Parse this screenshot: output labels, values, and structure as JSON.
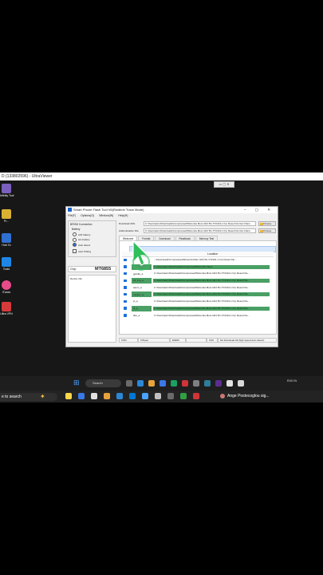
{
  "remote_viewer": {
    "title": "D (133802596) - UltraViewer",
    "controls": "▭ ▢ ✕"
  },
  "desktop_icons": [
    {
      "label": "Infinity Tool",
      "color": "#7a5fbf"
    },
    {
      "label": "Pr...",
      "color": "#d9b033"
    },
    {
      "label": "Hub Yo",
      "color": "#2f6fd0"
    },
    {
      "label": "Tools",
      "color": "#1e87e5"
    },
    {
      "label": "iTunes",
      "color": "#e84b8a"
    },
    {
      "label": "Ultra VPN",
      "color": "#d63a3a"
    }
  ],
  "app_window": {
    "title": "Smart Phone Flash Tool V6(Runtime Trace Mode)",
    "window_controls": "–  ▢  ✕",
    "menu": [
      "File(F)",
      "Options(O)",
      "Window(W)",
      "Help(H)"
    ],
    "left_panel": {
      "group_title": "BROM Connection",
      "battery_label": "Battery",
      "battery_options": [
        {
          "label": "with battery",
          "selected": false
        },
        {
          "label": "w/o battery",
          "selected": false
        },
        {
          "label": "Auto detect",
          "selected": true
        }
      ],
      "auto_polling_label": "Auto Polling",
      "chip_label": "Chip:",
      "chip_value": "MT6855",
      "device_info_label": "Device Info"
    },
    "download_xml": {
      "label": "Download-XML",
      "value": "C:\\Users\\asim\\Downloads\\Compressed\\Motorola Moto G64 5G XT2431-1 Frp Reset File Nov Files\\",
      "button": "Choose"
    },
    "auth_file": {
      "label": "Authentication File",
      "value": "C:\\Users\\asim\\Downloads\\Compressed\\Motorola Moto G64 5G XT2431-1 Frp Reset File Nov Files\\",
      "button": "Choose"
    },
    "tabs": [
      "Welcome",
      "Format",
      "Download",
      "Readback",
      "Memory Test"
    ],
    "active_tab": "Welcome",
    "table_header": "Location",
    "rows": [
      {
        "name": "",
        "path": "...\\Downloads\\Compressed\\Motorola Moto G64 5G XT2431-1 Frp Reset File...",
        "highlight": false
      },
      {
        "name": "",
        "path": "C:\\Users\\asim\\Downloads\\Compressed\\Motorola Close",
        "highlight": true
      },
      {
        "name": "gpt/dle_a",
        "path": "C:\\Users\\asim\\Downloads\\Compressed\\Motorola Moto G64 5G XT2431-1 Frp Reset File...",
        "highlight": false
      },
      {
        "name": "ptl_img_a",
        "path": "C:\\Users\\asim\\Downloads\\Compressed\\Motorola Moto G64 5G XT2431-1 Frp Reset File...",
        "highlight": true
      },
      {
        "name": "aspm_a",
        "path": "C:\\Users\\asim\\Downloads\\Compressed\\Motorola Moto G64 5G XT2431-1 Frp Reset File...",
        "highlight": false
      },
      {
        "name": "mcupm_a",
        "path": "C:\\Users\\asim\\Downloads\\Compressed\\Motorola Moto G64 5G XT2431-1 Frp Reset File...",
        "highlight": true
      },
      {
        "name": "pi_a",
        "path": "C:\\Users\\asim\\Downloads\\Compressed\\Motorola Moto G64 5G XT2431-1 Frp Reset File...",
        "highlight": false
      },
      {
        "name": "tk_a",
        "path": "C:\\Users\\asim\\Downloads\\Compressed\\Motorola Moto G64 5G XT2431-1 Frp Reset File...",
        "highlight": true
      },
      {
        "name": "tfbo_a",
        "path": "C:\\Users\\asim\\Downloads\\Compressed\\Motorola Moto G64 5G XT2431-1 Frp Reset File...",
        "highlight": false
      }
    ],
    "status": {
      "speed": "0 B/s",
      "bytes": "0 Bytes",
      "storage": "EMMC",
      "interface": "",
      "time": "0:00",
      "message": "DA Download All (high speed,auto detect)"
    }
  },
  "remote_taskbar": {
    "search_placeholder": "Search",
    "tray_lang": "ENG IN",
    "tray_time": "..."
  },
  "local_taskbar": {
    "search_placeholder": "e to search",
    "notification": "Ange Postecoglou sig..."
  }
}
